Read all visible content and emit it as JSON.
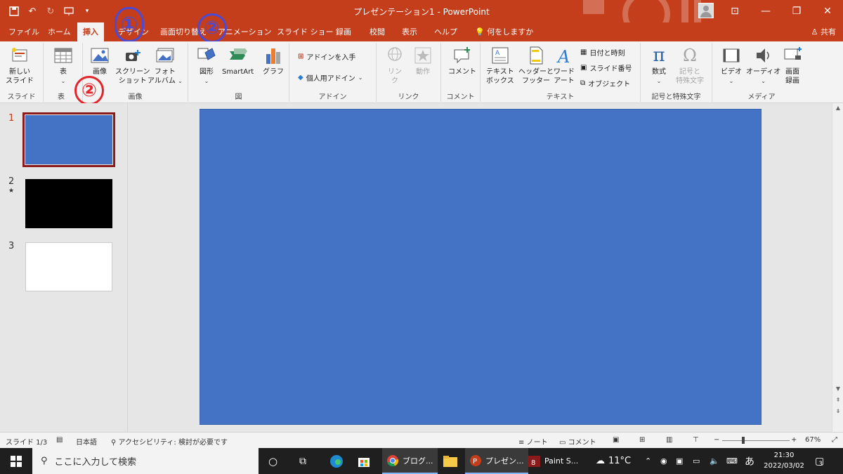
{
  "window": {
    "title": "プレゼンテーション1  -  PowerPoint",
    "qat": [
      "save-icon",
      "undo-icon",
      "redo-icon",
      "present-icon",
      "customize-icon"
    ]
  },
  "tabs": [
    {
      "label": "ファイル"
    },
    {
      "label": "ホーム"
    },
    {
      "label": "挿入"
    },
    {
      "label": "デザイン"
    },
    {
      "label": "画面切り替え"
    },
    {
      "label": "アニメーション"
    },
    {
      "label": "スライド ショー"
    },
    {
      "label": "録画"
    },
    {
      "label": "校閲"
    },
    {
      "label": "表示"
    },
    {
      "label": "ヘルプ"
    },
    {
      "label": "何をしますか"
    }
  ],
  "share_label": "共有",
  "ribbon": {
    "slides": {
      "label": "スライド",
      "new_slide": "新しい\nスライド"
    },
    "table": {
      "label": "表",
      "table_btn": "表"
    },
    "images": {
      "label": "画像",
      "picture": "画像",
      "screenshot": "スクリーン\nショット",
      "album": "フォト\nアルバム"
    },
    "illustrations": {
      "label": "図",
      "shapes": "図形",
      "smartart": "SmartArt",
      "chart": "グラフ"
    },
    "addins": {
      "label": "アドイン",
      "get": "アドインを入手",
      "my": "個人用アドイン"
    },
    "links": {
      "label": "リンク",
      "link": "リン\nク",
      "action": "動作"
    },
    "comments": {
      "label": "コメント",
      "comment": "コメント"
    },
    "text": {
      "label": "テキスト",
      "textbox": "テキスト\nボックス",
      "header": "ヘッダーと\nフッター",
      "wordart": "ワード\nアート",
      "date": "日付と時刻",
      "slidenum": "スライド番号",
      "object": "オブジェクト"
    },
    "symbols": {
      "label": "記号と特殊文字",
      "equation": "数式",
      "symbol": "記号と\n特殊文字"
    },
    "media": {
      "label": "メディア",
      "video": "ビデオ",
      "audio": "オーディオ",
      "screenrec": "画面\n録画"
    }
  },
  "annotations": {
    "one": "①",
    "two_a": "②",
    "two_b": "②"
  },
  "thumbnails": [
    {
      "num": "1",
      "color": "#4472c4"
    },
    {
      "num": "2",
      "color": "#000000",
      "star": "★"
    },
    {
      "num": "3",
      "color": "#ffffff"
    }
  ],
  "status": {
    "slide": "スライド 1/3",
    "lang": "日本語",
    "access": "アクセシビリティ: 検討が必要です",
    "notes": "ノート",
    "comments": "コメント",
    "zoom_minus": "−",
    "zoom_plus": "+",
    "zoom": "67%"
  },
  "taskbar": {
    "search_placeholder": "ここに入力して検索",
    "chrome": "ブログ...",
    "ppt": "プレゼン...",
    "paint": "Paint S...",
    "temp": "11°C",
    "ime": "あ",
    "time": "21:30",
    "date": "2022/03/02",
    "notif": "3"
  },
  "colors": {
    "accent": "#c43e1c",
    "slide": "#4472c4",
    "annotation_blue": "#4b4bd6",
    "annotation_red": "#e3262b"
  }
}
